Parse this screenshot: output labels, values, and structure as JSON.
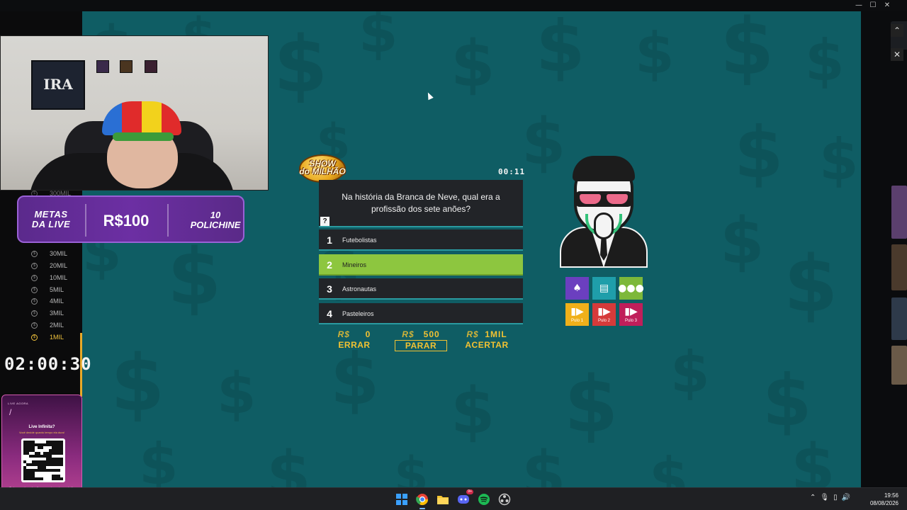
{
  "window": {
    "controls": [
      "—",
      "☐",
      "✕"
    ]
  },
  "overlay": {
    "metas": {
      "label": "METAS\nDA LIVE",
      "value": "R$100",
      "goal": "10\nPOLICHINE"
    },
    "ladder": {
      "top_label": "300MIL",
      "items": [
        "30MIL",
        "20MIL",
        "10MIL",
        "5MIL",
        "4MIL",
        "3MIL",
        "2MIL",
        "1MIL"
      ],
      "active": "1MIL"
    },
    "stream_timer": "02:00:30",
    "qr_card": {
      "header": "LIVE AGORA",
      "title": "Live Infinita?",
      "subtitle": "Você decide quanto tempo ela dura!",
      "footer": "Todas as subs e doações aumentam o tempo da live",
      "link": "PIXUS.COM/GERAGRA"
    },
    "poster_text": "IRA"
  },
  "game": {
    "logo": "SHOW\ndo MILHÃO",
    "timer": "00:11",
    "question": "Na história da Branca de Neve, qual era a profissão dos sete anões?",
    "help_icon": "?",
    "answers": [
      {
        "number": "1",
        "text": "Futebolistas",
        "selected": false
      },
      {
        "number": "2",
        "text": "Mineiros",
        "selected": true
      },
      {
        "number": "3",
        "text": "Astronautas",
        "selected": false
      },
      {
        "number": "4",
        "text": "Pasteleiros",
        "selected": false
      }
    ],
    "prizes": [
      {
        "currency": "R$",
        "amount": "0",
        "action": "ERRAR"
      },
      {
        "currency": "R$",
        "amount": "500",
        "action": "PARAR"
      },
      {
        "currency": "R$",
        "amount": "1MIL",
        "action": "ACERTAR"
      }
    ],
    "lifelines": [
      {
        "icon": "cards-icon",
        "glyph": "🂠",
        "label": "",
        "color": "#6b3fbf"
      },
      {
        "icon": "money-icon",
        "glyph": "▤",
        "label": "",
        "color": "#1f9eaa"
      },
      {
        "icon": "audience-icon",
        "glyph": "●●●",
        "label": "",
        "color": "#7db83a"
      },
      {
        "icon": "skip-icon",
        "glyph": "▶▶",
        "label": "Pulo 1",
        "color": "#f0b01a"
      },
      {
        "icon": "skip-icon",
        "glyph": "▶▶",
        "label": "Pulo 2",
        "color": "#d63a3a"
      },
      {
        "icon": "skip-icon",
        "glyph": "▶▶",
        "label": "Pulo 3",
        "color": "#c01e5a"
      }
    ]
  },
  "taskbar": {
    "apps": [
      {
        "name": "windows-start-icon",
        "color": "#3aa0ff"
      },
      {
        "name": "chrome-icon",
        "color": "#e94235"
      },
      {
        "name": "file-explorer-icon",
        "color": "#f4c430"
      },
      {
        "name": "discord-icon",
        "color": "#5865f2",
        "badge": "9+"
      },
      {
        "name": "spotify-icon",
        "color": "#1db954"
      },
      {
        "name": "obs-icon",
        "color": "#cccccc"
      }
    ],
    "time": "19:56",
    "date": "08/08/2026"
  }
}
